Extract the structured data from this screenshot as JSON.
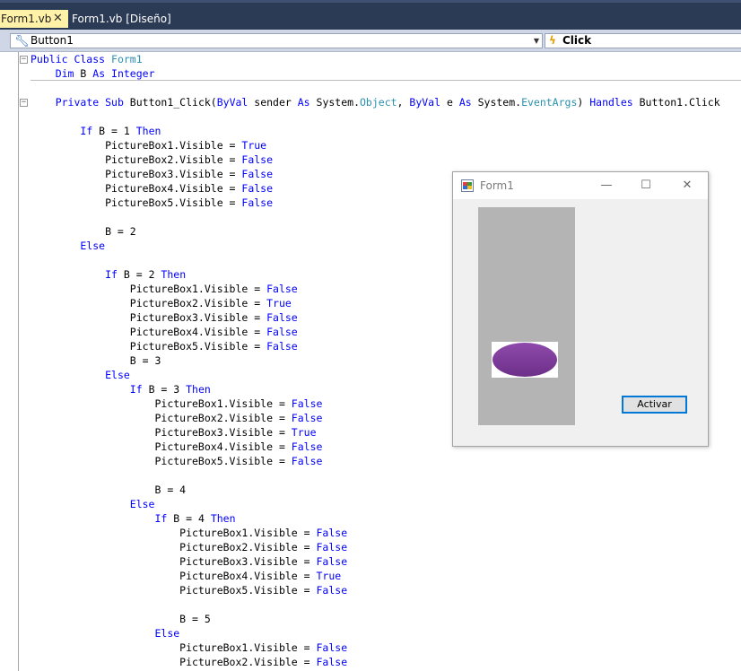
{
  "tabs": [
    {
      "label": "Form1.vb",
      "close": "✕"
    },
    {
      "label": "Form1.vb [Diseño]"
    }
  ],
  "nav": {
    "object": "Button1",
    "event": "Click"
  },
  "code": [
    [
      [
        "k",
        "Public Class "
      ],
      [
        "t",
        "Form1"
      ]
    ],
    [
      [
        "p",
        "    "
      ],
      [
        "k",
        "Dim"
      ],
      [
        "p",
        " B "
      ],
      [
        "k",
        "As Integer"
      ]
    ],
    [],
    [
      [
        "p",
        "    "
      ],
      [
        "k",
        "Private Sub"
      ],
      [
        "p",
        " Button1_Click("
      ],
      [
        "k",
        "ByVal"
      ],
      [
        "p",
        " sender "
      ],
      [
        "k",
        "As"
      ],
      [
        "p",
        " System."
      ],
      [
        "t",
        "Object"
      ],
      [
        "p",
        ", "
      ],
      [
        "k",
        "ByVal"
      ],
      [
        "p",
        " e "
      ],
      [
        "k",
        "As"
      ],
      [
        "p",
        " System."
      ],
      [
        "t",
        "EventArgs"
      ],
      [
        "p",
        ") "
      ],
      [
        "k",
        "Handles"
      ],
      [
        "p",
        " Button1.Click"
      ]
    ],
    [],
    [
      [
        "p",
        "        "
      ],
      [
        "k",
        "If"
      ],
      [
        "p",
        " B = 1 "
      ],
      [
        "k",
        "Then"
      ]
    ],
    [
      [
        "p",
        "            PictureBox1.Visible = "
      ],
      [
        "k",
        "True"
      ]
    ],
    [
      [
        "p",
        "            PictureBox2.Visible = "
      ],
      [
        "k",
        "False"
      ]
    ],
    [
      [
        "p",
        "            PictureBox3.Visible = "
      ],
      [
        "k",
        "False"
      ]
    ],
    [
      [
        "p",
        "            PictureBox4.Visible = "
      ],
      [
        "k",
        "False"
      ]
    ],
    [
      [
        "p",
        "            PictureBox5.Visible = "
      ],
      [
        "k",
        "False"
      ]
    ],
    [],
    [
      [
        "p",
        "            B = 2"
      ]
    ],
    [
      [
        "p",
        "        "
      ],
      [
        "k",
        "Else"
      ]
    ],
    [],
    [
      [
        "p",
        "            "
      ],
      [
        "k",
        "If"
      ],
      [
        "p",
        " B = 2 "
      ],
      [
        "k",
        "Then"
      ]
    ],
    [
      [
        "p",
        "                PictureBox1.Visible = "
      ],
      [
        "k",
        "False"
      ]
    ],
    [
      [
        "p",
        "                PictureBox2.Visible = "
      ],
      [
        "k",
        "True"
      ]
    ],
    [
      [
        "p",
        "                PictureBox3.Visible = "
      ],
      [
        "k",
        "False"
      ]
    ],
    [
      [
        "p",
        "                PictureBox4.Visible = "
      ],
      [
        "k",
        "False"
      ]
    ],
    [
      [
        "p",
        "                PictureBox5.Visible = "
      ],
      [
        "k",
        "False"
      ]
    ],
    [
      [
        "p",
        "                B = 3"
      ]
    ],
    [
      [
        "p",
        "            "
      ],
      [
        "k",
        "Else"
      ]
    ],
    [
      [
        "p",
        "                "
      ],
      [
        "k",
        "If"
      ],
      [
        "p",
        " B = 3 "
      ],
      [
        "k",
        "Then"
      ]
    ],
    [
      [
        "p",
        "                    PictureBox1.Visible = "
      ],
      [
        "k",
        "False"
      ]
    ],
    [
      [
        "p",
        "                    PictureBox2.Visible = "
      ],
      [
        "k",
        "False"
      ]
    ],
    [
      [
        "p",
        "                    PictureBox3.Visible = "
      ],
      [
        "k",
        "True"
      ]
    ],
    [
      [
        "p",
        "                    PictureBox4.Visible = "
      ],
      [
        "k",
        "False"
      ]
    ],
    [
      [
        "p",
        "                    PictureBox5.Visible = "
      ],
      [
        "k",
        "False"
      ]
    ],
    [],
    [
      [
        "p",
        "                    B = 4"
      ]
    ],
    [
      [
        "p",
        "                "
      ],
      [
        "k",
        "Else"
      ]
    ],
    [
      [
        "p",
        "                    "
      ],
      [
        "k",
        "If"
      ],
      [
        "p",
        " B = 4 "
      ],
      [
        "k",
        "Then"
      ]
    ],
    [
      [
        "p",
        "                        PictureBox1.Visible = "
      ],
      [
        "k",
        "False"
      ]
    ],
    [
      [
        "p",
        "                        PictureBox2.Visible = "
      ],
      [
        "k",
        "False"
      ]
    ],
    [
      [
        "p",
        "                        PictureBox3.Visible = "
      ],
      [
        "k",
        "False"
      ]
    ],
    [
      [
        "p",
        "                        PictureBox4.Visible = "
      ],
      [
        "k",
        "True"
      ]
    ],
    [
      [
        "p",
        "                        PictureBox5.Visible = "
      ],
      [
        "k",
        "False"
      ]
    ],
    [],
    [
      [
        "p",
        "                        B = 5"
      ]
    ],
    [
      [
        "p",
        "                    "
      ],
      [
        "k",
        "Else"
      ]
    ],
    [
      [
        "p",
        "                        PictureBox1.Visible = "
      ],
      [
        "k",
        "False"
      ]
    ],
    [
      [
        "p",
        "                        PictureBox2.Visible = "
      ],
      [
        "k",
        "False"
      ]
    ]
  ],
  "form": {
    "title": "Form1",
    "button_label": "Activar",
    "minimize": "—",
    "maximize": "☐",
    "close": "✕"
  },
  "colors": {
    "tabbar": "#2b3a55",
    "active_tab": "#fff1a8",
    "keyword": "#0000ff",
    "type": "#2b91af",
    "picturebox": "#b4b4b4",
    "ellipse": "#7f3a9a"
  },
  "icons": {
    "nav_object": "wrench-icon",
    "nav_event": "lightning-icon",
    "form_app": "windows-form-icon"
  }
}
